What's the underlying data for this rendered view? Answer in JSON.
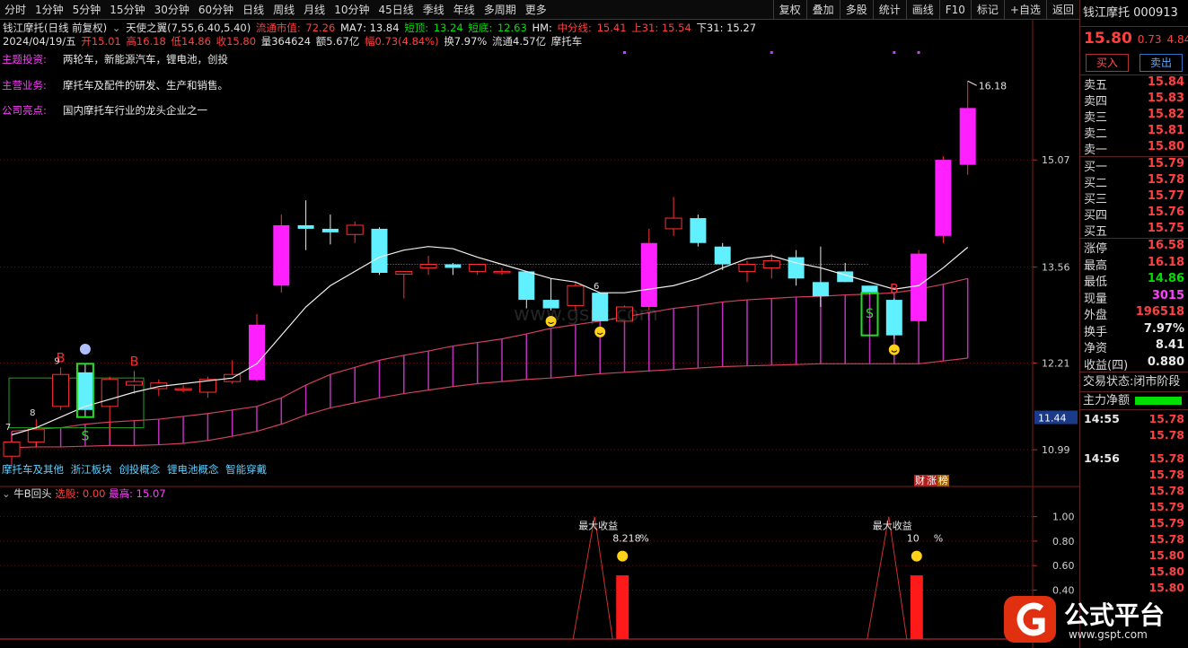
{
  "toolbar": {
    "periods": [
      "分时",
      "1分钟",
      "5分钟",
      "15分钟",
      "30分钟",
      "60分钟",
      "日线",
      "周线",
      "月线",
      "10分钟",
      "45日线",
      "季线",
      "年线",
      "多周期",
      "更多"
    ],
    "tools": [
      "复权",
      "叠加",
      "多股",
      "统计",
      "画线",
      "F10",
      "标记",
      "+自选",
      "返回"
    ]
  },
  "info": {
    "title": "钱江摩托(日线 前复权)",
    "indicator": "天使之翼(7,55,6.40,5.40)",
    "cap_label": "流通市值:",
    "cap_value": "72.26",
    "ma7": "MA7: 13.84",
    "top_label": "短顶:",
    "top_value": "13.24",
    "bottom_label": "短底:",
    "bottom_value": "12.63",
    "hm": "HM:",
    "mid_label": "中分线:",
    "mid_value": "15.41",
    "up31": "上31: 15.54",
    "down31": "下31: 15.27",
    "date": "2024/04/19/五",
    "open": "开15.01",
    "high": "高16.18",
    "low": "低14.86",
    "close": "收15.80",
    "volume": "量364624",
    "amount": "额5.67亿",
    "amp": "幅0.73(4.84%)",
    "turnover": "换7.97%",
    "float": "流通4.57亿",
    "sector": "摩托车"
  },
  "topics": [
    {
      "key": "主题投资:",
      "value": "两轮车，新能源汽车，锂电池，创投"
    },
    {
      "key": "主营业务:",
      "value": "摩托车及配件的研发、生产和销售。"
    },
    {
      "key": "公司亮点:",
      "value": "国内摩托车行业的龙头企业之一"
    }
  ],
  "concepts": [
    "摩托车及其他",
    "浙江板块",
    "创投概念",
    "锂电池概念",
    "智能穿戴"
  ],
  "fin_badge": [
    "财",
    "涨",
    "榜"
  ],
  "watermark": "www.gspt.com",
  "price_axis": [
    "15.07",
    "13.56",
    "12.21",
    "10.99"
  ],
  "current_axis_label": "11.44",
  "sub_axis": [
    "1.00",
    "0.80",
    "0.60",
    "0.40"
  ],
  "ind_header": {
    "name": "牛B回头",
    "sel_label": "选股:",
    "sel_value": "0.00",
    "high_label": "最高:",
    "high_value": "15.07"
  },
  "sub_panel": {
    "label1": "最大收益",
    "value1": "8.218",
    "unit1": "%",
    "label2": "最大收益",
    "value2": "10",
    "unit2": "%",
    "bar1": 0.52,
    "bar2": 0.52
  },
  "marks": {
    "high_label": "16.18",
    "signals": [
      {
        "type": "B",
        "bar": 2
      },
      {
        "type": "S",
        "bar": 3
      },
      {
        "type": "B",
        "bar": 5
      },
      {
        "type": "B",
        "bar": 36
      },
      {
        "type": "S",
        "bar": 35
      }
    ],
    "counts": [
      {
        "text": "7",
        "bar": 0
      },
      {
        "text": "8",
        "bar": 1
      },
      {
        "text": "9",
        "bar": 2
      },
      {
        "text": "6",
        "bar": 24
      }
    ]
  },
  "chart_data": {
    "type": "candlestick",
    "title": "",
    "ylim": [
      10.6,
      16.6
    ],
    "candles": [
      [
        10.9,
        11.1,
        10.75,
        11.22
      ],
      [
        11.1,
        11.28,
        11.02,
        11.42
      ],
      [
        11.6,
        12.05,
        11.55,
        12.15
      ],
      [
        12.08,
        11.55,
        11.45,
        12.2
      ],
      [
        11.6,
        11.98,
        11.15,
        12.02
      ],
      [
        11.9,
        11.95,
        11.78,
        12.1
      ],
      [
        11.85,
        11.93,
        11.75,
        11.98
      ],
      [
        11.85,
        11.85,
        11.8,
        11.9
      ],
      [
        11.8,
        11.98,
        11.72,
        12.02
      ],
      [
        11.95,
        12.05,
        11.92,
        12.25
      ],
      [
        11.97,
        12.75,
        11.95,
        12.9
      ],
      [
        13.3,
        14.15,
        13.2,
        14.3
      ],
      [
        14.15,
        14.1,
        13.8,
        14.5
      ],
      [
        14.1,
        14.05,
        13.88,
        14.3
      ],
      [
        14.02,
        14.15,
        13.9,
        14.2
      ],
      [
        14.1,
        13.48,
        13.45,
        14.12
      ],
      [
        13.46,
        13.5,
        13.12,
        13.5
      ],
      [
        13.55,
        13.6,
        13.45,
        13.72
      ],
      [
        13.6,
        13.55,
        13.45,
        13.62
      ],
      [
        13.5,
        13.6,
        13.45,
        13.6
      ],
      [
        13.5,
        13.5,
        13.45,
        13.55
      ],
      [
        13.5,
        13.1,
        12.98,
        13.5
      ],
      [
        13.1,
        12.98,
        12.95,
        13.4
      ],
      [
        13.02,
        13.3,
        12.95,
        13.36
      ],
      [
        13.2,
        12.8,
        12.8,
        13.2
      ],
      [
        12.8,
        13.0,
        12.75,
        13.02
      ],
      [
        13.0,
        13.9,
        12.95,
        14.1
      ],
      [
        14.1,
        14.25,
        14.0,
        14.55
      ],
      [
        14.25,
        13.9,
        13.85,
        14.3
      ],
      [
        13.85,
        13.6,
        13.52,
        13.9
      ],
      [
        13.5,
        13.6,
        13.35,
        13.65
      ],
      [
        13.55,
        13.65,
        13.4,
        13.75
      ],
      [
        13.7,
        13.4,
        13.3,
        13.8
      ],
      [
        13.35,
        13.15,
        13.0,
        13.85
      ],
      [
        13.5,
        13.35,
        13.35,
        13.62
      ],
      [
        13.3,
        13.2,
        13.18,
        13.22
      ],
      [
        13.1,
        12.6,
        12.55,
        13.12
      ],
      [
        12.8,
        13.75,
        12.75,
        13.8
      ],
      [
        14.0,
        15.07,
        13.9,
        15.12
      ],
      [
        15.0,
        15.8,
        14.86,
        16.18
      ]
    ],
    "ma7": [
      11.2,
      11.3,
      11.45,
      11.6,
      11.7,
      11.8,
      11.88,
      11.92,
      11.96,
      12.0,
      12.2,
      12.6,
      13.0,
      13.3,
      13.5,
      13.7,
      13.8,
      13.85,
      13.82,
      13.7,
      13.6,
      13.5,
      13.4,
      13.35,
      13.2,
      13.2,
      13.25,
      13.3,
      13.4,
      13.55,
      13.68,
      13.72,
      13.62,
      13.55,
      13.45,
      13.35,
      13.25,
      13.3,
      13.55,
      13.84
    ],
    "band_top": [
      11.25,
      11.28,
      11.3,
      11.35,
      11.38,
      11.4,
      11.42,
      11.46,
      11.5,
      11.55,
      11.6,
      11.72,
      11.9,
      12.05,
      12.15,
      12.25,
      12.32,
      12.38,
      12.45,
      12.5,
      12.55,
      12.62,
      12.7,
      12.75,
      12.8,
      12.86,
      12.92,
      12.98,
      13.02,
      13.07,
      13.1,
      13.12,
      13.14,
      13.15,
      13.17,
      13.18,
      13.2,
      13.25,
      13.32,
      13.4
    ],
    "band_bottom": [
      11.02,
      11.03,
      11.03,
      11.04,
      11.05,
      11.05,
      11.06,
      11.08,
      11.12,
      11.18,
      11.25,
      11.35,
      11.48,
      11.58,
      11.65,
      11.72,
      11.78,
      11.83,
      11.88,
      11.92,
      11.95,
      11.98,
      12.0,
      12.03,
      12.06,
      12.08,
      12.1,
      12.12,
      12.14,
      12.16,
      12.17,
      12.18,
      12.19,
      12.2,
      12.2,
      12.2,
      12.2,
      12.2,
      12.24,
      12.28
    ],
    "support_line": 13.6
  },
  "right_panel": {
    "name": "钱江摩托",
    "code": "000913",
    "price": "15.80",
    "change": "0.73",
    "pct": "4.84%",
    "buy_label": "买入",
    "sell_label": "卖出",
    "asks": [
      {
        "label": "卖五",
        "value": "15.84"
      },
      {
        "label": "卖四",
        "value": "15.83"
      },
      {
        "label": "卖三",
        "value": "15.82"
      },
      {
        "label": "卖二",
        "value": "15.81"
      },
      {
        "label": "卖一",
        "value": "15.80"
      }
    ],
    "bids": [
      {
        "label": "买一",
        "value": "15.79"
      },
      {
        "label": "买二",
        "value": "15.78"
      },
      {
        "label": "买三",
        "value": "15.77"
      },
      {
        "label": "买四",
        "value": "15.76"
      },
      {
        "label": "买五",
        "value": "15.75"
      }
    ],
    "stats": [
      {
        "label": "涨停",
        "value": "16.58",
        "color": "#ff4040"
      },
      {
        "label": "最高",
        "value": "16.18",
        "color": "#ff4040"
      },
      {
        "label": "最低",
        "value": "14.86",
        "color": "#00e000"
      },
      {
        "label": "现量",
        "value": "3015",
        "color": "#ff40ff"
      },
      {
        "label": "外盘",
        "value": "196518",
        "color": "#ff4040"
      },
      {
        "label": "换手",
        "value": "7.97%",
        "color": "#e8e8e8"
      },
      {
        "label": "净资",
        "value": "8.41",
        "color": "#e8e8e8"
      },
      {
        "label": "收益(四)",
        "value": "0.880",
        "color": "#e8e8e8"
      }
    ],
    "trade_state": "交易状态:闭市阶段",
    "main_flow": "主力净额",
    "ticks_a": [
      {
        "time": "14:55",
        "price": "15.78"
      },
      {
        "time": "",
        "price": "15.78"
      }
    ],
    "ticks_b": [
      {
        "time": "14:56",
        "price": "15.78"
      },
      {
        "time": "",
        "price": "15.78"
      },
      {
        "time": "",
        "price": "15.78"
      },
      {
        "time": "",
        "price": "15.79"
      },
      {
        "time": "",
        "price": "15.79"
      },
      {
        "time": "",
        "price": "15.78"
      },
      {
        "time": "",
        "price": "15.80"
      },
      {
        "time": "",
        "price": "15.80"
      },
      {
        "time": "",
        "price": "15.80"
      }
    ]
  },
  "logo": {
    "text": "公式平台",
    "url": "www.gspt.com"
  }
}
